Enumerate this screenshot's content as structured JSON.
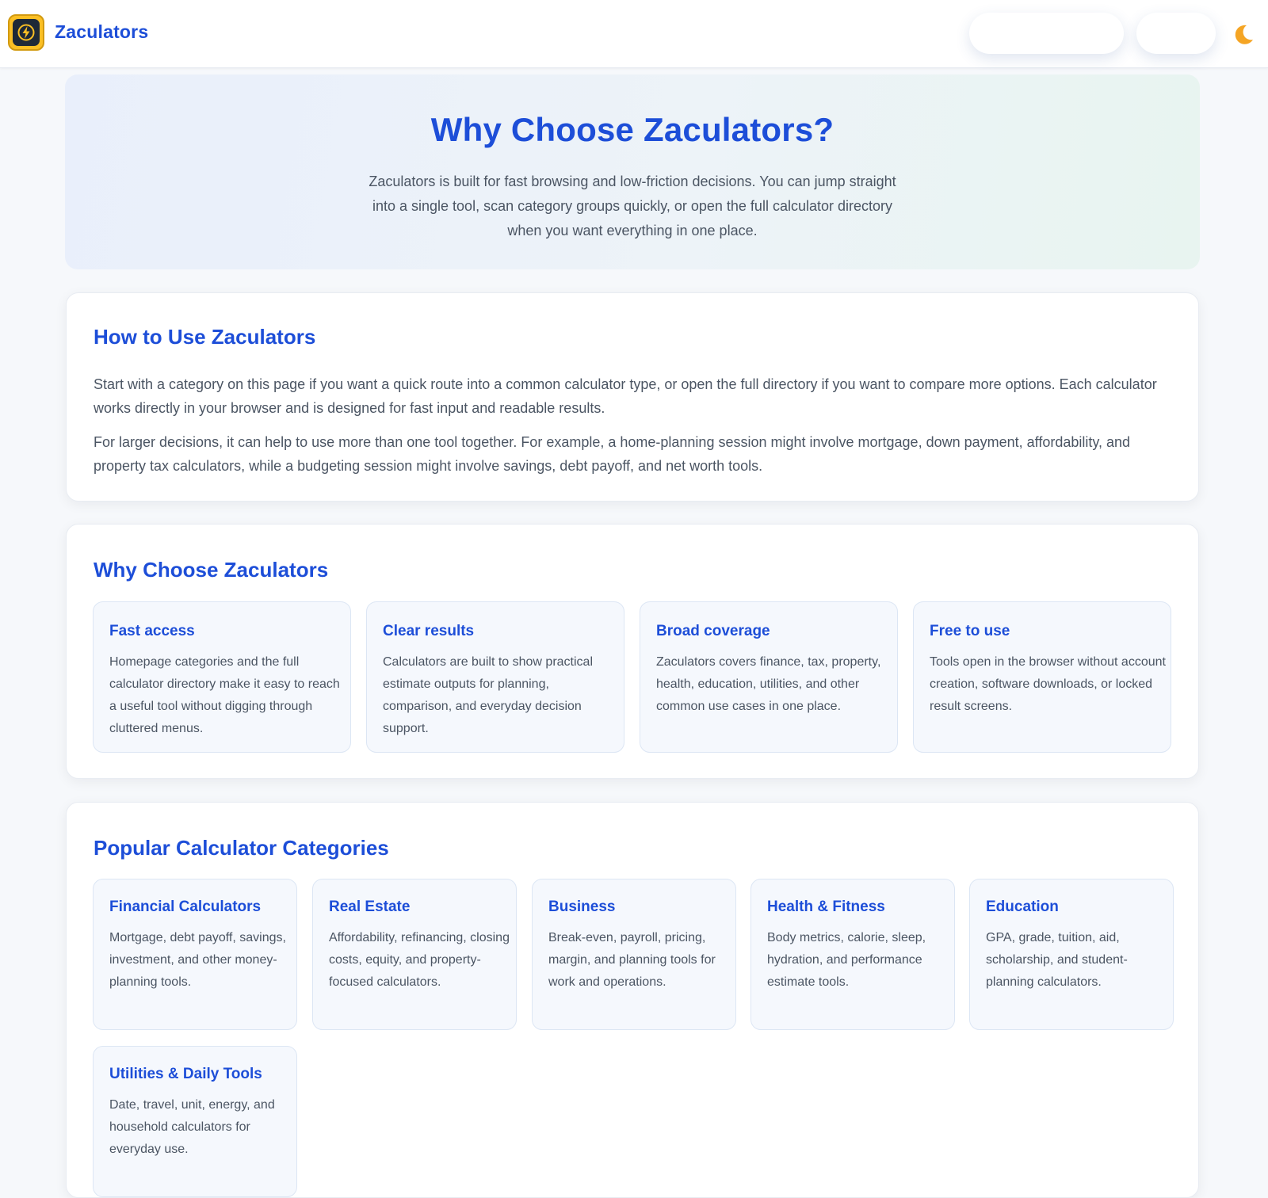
{
  "header": {
    "brand": "Zaculators",
    "colors": {
      "accent": "#1d4ed8",
      "logo_bg": "#fbbf24",
      "moon": "#f5a524"
    }
  },
  "hero": {
    "title": "Why Choose Zaculators?",
    "text": "Zaculators is built for fast browsing and low-friction decisions. You can jump straight into a single tool, scan category groups quickly, or open the full calculator directory when you want everything in one place."
  },
  "how_to": {
    "title": "How to Use Zaculators",
    "p1": "Start with a category on this page if you want a quick route into a common calculator type, or open the full directory if you want to compare more options. Each calculator works directly in your browser and is designed for fast input and readable results.",
    "p2": "For larger decisions, it can help to use more than one tool together. For example, a home-planning session might involve mortgage, down payment, affordability, and property tax calculators, while a budgeting session might involve savings, debt payoff, and net worth tools."
  },
  "why": {
    "title": "Why Choose Zaculators",
    "features": [
      {
        "title": "Fast access",
        "text": "Homepage categories and the full calculator directory make it easy to reach a useful tool without digging through cluttered menus."
      },
      {
        "title": "Clear results",
        "text": "Calculators are built to show practical estimate outputs for planning, comparison, and everyday decision support."
      },
      {
        "title": "Broad coverage",
        "text": "Zaculators covers finance, tax, property, health, education, utilities, and other common use cases in one place."
      },
      {
        "title": "Free to use",
        "text": "Tools open in the browser without account creation, software downloads, or locked result screens."
      }
    ]
  },
  "popular": {
    "title": "Popular Calculator Categories",
    "categories": [
      {
        "title": "Financial Calculators",
        "text": "Mortgage, debt payoff, savings, investment, and other money-planning tools."
      },
      {
        "title": "Real Estate",
        "text": "Affordability, refinancing, closing costs, equity, and property-focused calculators."
      },
      {
        "title": "Business",
        "text": "Break-even, payroll, pricing, margin, and planning tools for work and operations."
      },
      {
        "title": "Health & Fitness",
        "text": "Body metrics, calorie, sleep, hydration, and performance estimate tools."
      },
      {
        "title": "Education",
        "text": "GPA, grade, tuition, aid, scholarship, and student-planning calculators."
      },
      {
        "title": "Utilities & Daily Tools",
        "text": "Date, travel, unit, energy, and household calculators for everyday use."
      }
    ]
  }
}
